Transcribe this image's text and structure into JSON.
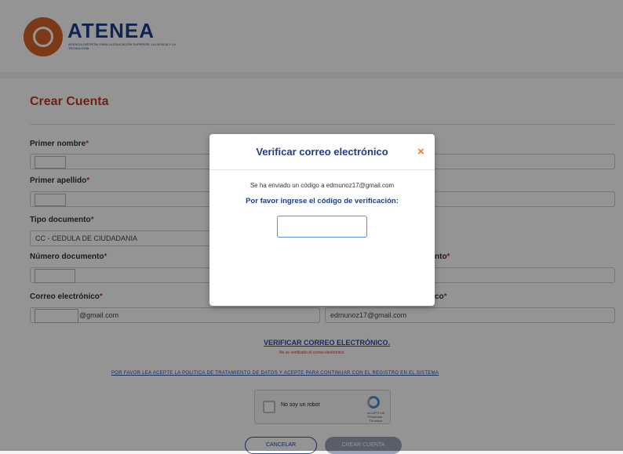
{
  "brand": {
    "name": "ATENEA",
    "tagline": "AGENCIA DISTRITAL PARA LA EDUCACIÓN SUPERIOR, LA CIENCIA Y LA TECNOLOGÍA"
  },
  "form": {
    "title": "Crear Cuenta",
    "required_mark": "*",
    "fields": {
      "primer_nombre": {
        "label": "Primer nombre"
      },
      "primer_apellido": {
        "label": "Primer apellido"
      },
      "tipo_documento": {
        "label": "Tipo documento",
        "value": "CC - CEDULA DE CIUDADANIA"
      },
      "numero_documento": {
        "label": "Número documento"
      },
      "right_label_partial": "nto",
      "correo": {
        "label": "Correo electrónico",
        "value_visible": "@gmail.com"
      },
      "confirm_correo": {
        "label_partial": "co",
        "value": "edmunoz17@gmail.com"
      }
    },
    "verify_link": "VERIFICAR CORREO ELECTRÓNICO.",
    "verify_note": "No se verificado el correo electrónico",
    "policy_text": "POR FAVOR LEA ACEPTE LA POLITICA DE TRATAMIENTO DE DATOS Y ACEPTE PARA CONTINUAR CON EL REGISTRO EN EL SISTEMA",
    "captcha": {
      "label": "No soy un robot",
      "brand": "reCAPTCHA",
      "links": "Privacidad - Términos"
    },
    "cancel_label": "CANCELAR",
    "create_label": "CREAR CUENTA"
  },
  "modal": {
    "title": "Verificar correo electrónico",
    "close_symbol": "×",
    "message": "Se ha enviado un código a edmunoz17@gmail.com",
    "prompt": "Por favor ingrese el código de verificación:",
    "code_value": ""
  },
  "colors": {
    "brand_blue": "#1f3c88",
    "accent_red": "#c23b2b",
    "close_orange": "#ee7d22"
  }
}
